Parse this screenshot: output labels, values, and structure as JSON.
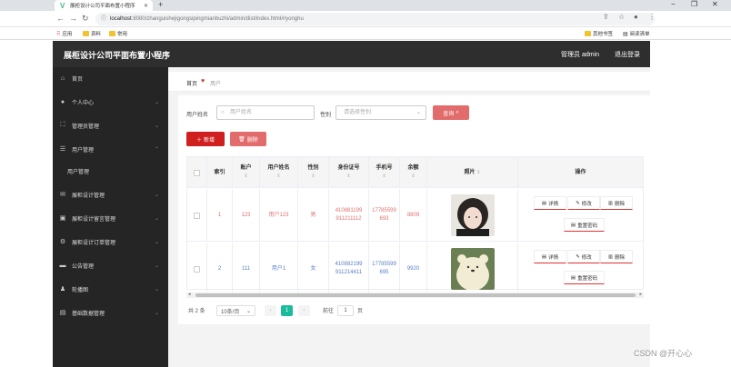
{
  "browser": {
    "tab_title": "展柜设计公司平面布置小程序",
    "new_tab": "+",
    "url_host": "localhost",
    "url_rest": ":8080/zhanguishejigongsipingmianbuzhi/admin/dist/index.html#/yonghu",
    "bookmarks": [
      "应用",
      "资料",
      "常用"
    ],
    "bookmarks_right": [
      "其他书签",
      "阅读清单"
    ]
  },
  "app": {
    "title": "展柜设计公司平面布置小程序",
    "admin_label": "管理员 admin",
    "logout_label": "退出登录"
  },
  "sidebar": {
    "items": [
      {
        "label": "首页",
        "icon": "home-icon",
        "glyph": "⌂"
      },
      {
        "label": "个人中心",
        "icon": "user-icon",
        "glyph": "●"
      },
      {
        "label": "管理员管理",
        "icon": "admin-icon",
        "glyph": "⛶"
      },
      {
        "label": "用户管理",
        "icon": "list-icon",
        "glyph": "☰"
      },
      {
        "label": "用户管理",
        "icon": "",
        "glyph": ""
      },
      {
        "label": "展柜设计管理",
        "icon": "mail-icon",
        "glyph": "✉"
      },
      {
        "label": "展柜设计留言管理",
        "icon": "comment-icon",
        "glyph": "▣"
      },
      {
        "label": "展柜设计订单管理",
        "icon": "settings-icon",
        "glyph": "⚙"
      },
      {
        "label": "公告管理",
        "icon": "notice-icon",
        "glyph": "▬"
      },
      {
        "label": "轮播图",
        "icon": "image-icon",
        "glyph": "♟"
      },
      {
        "label": "基础数据管理",
        "icon": "data-icon",
        "glyph": "▤"
      }
    ]
  },
  "breadcrumb": {
    "home": "首页",
    "current": "用户"
  },
  "filters": {
    "name_label": "用户姓名",
    "name_placeholder": "用户姓名",
    "gender_label": "性别",
    "gender_placeholder": "请选择性别",
    "search_label": "查询"
  },
  "actions": {
    "add_label": "新增",
    "delete_label": "删除"
  },
  "table": {
    "headers": [
      "索引",
      "账户",
      "用户姓名",
      "性别",
      "身份证号",
      "手机号",
      "余额",
      "照片",
      "操作"
    ],
    "rows": [
      {
        "index": "1",
        "account": "123",
        "name": "用户123",
        "gender": "男",
        "id_card": "410881199911211112",
        "phone": "17785599693",
        "balance": "8809",
        "color": "#e07070"
      },
      {
        "index": "2",
        "account": "111",
        "name": "用户1",
        "gender": "女",
        "id_card": "410882199911214411",
        "phone": "17785599695",
        "balance": "9920",
        "color": "#5a7fc4"
      }
    ],
    "row_actions": {
      "detail": "详情",
      "edit": "修改",
      "delete": "删除",
      "reset": "重置密码"
    }
  },
  "pagination": {
    "total": "共 2 条",
    "page_size": "10条/页",
    "current": "1",
    "goto": "前往",
    "goto_value": "1",
    "page_suffix": "页"
  },
  "watermark": "CSDN @开心心"
}
